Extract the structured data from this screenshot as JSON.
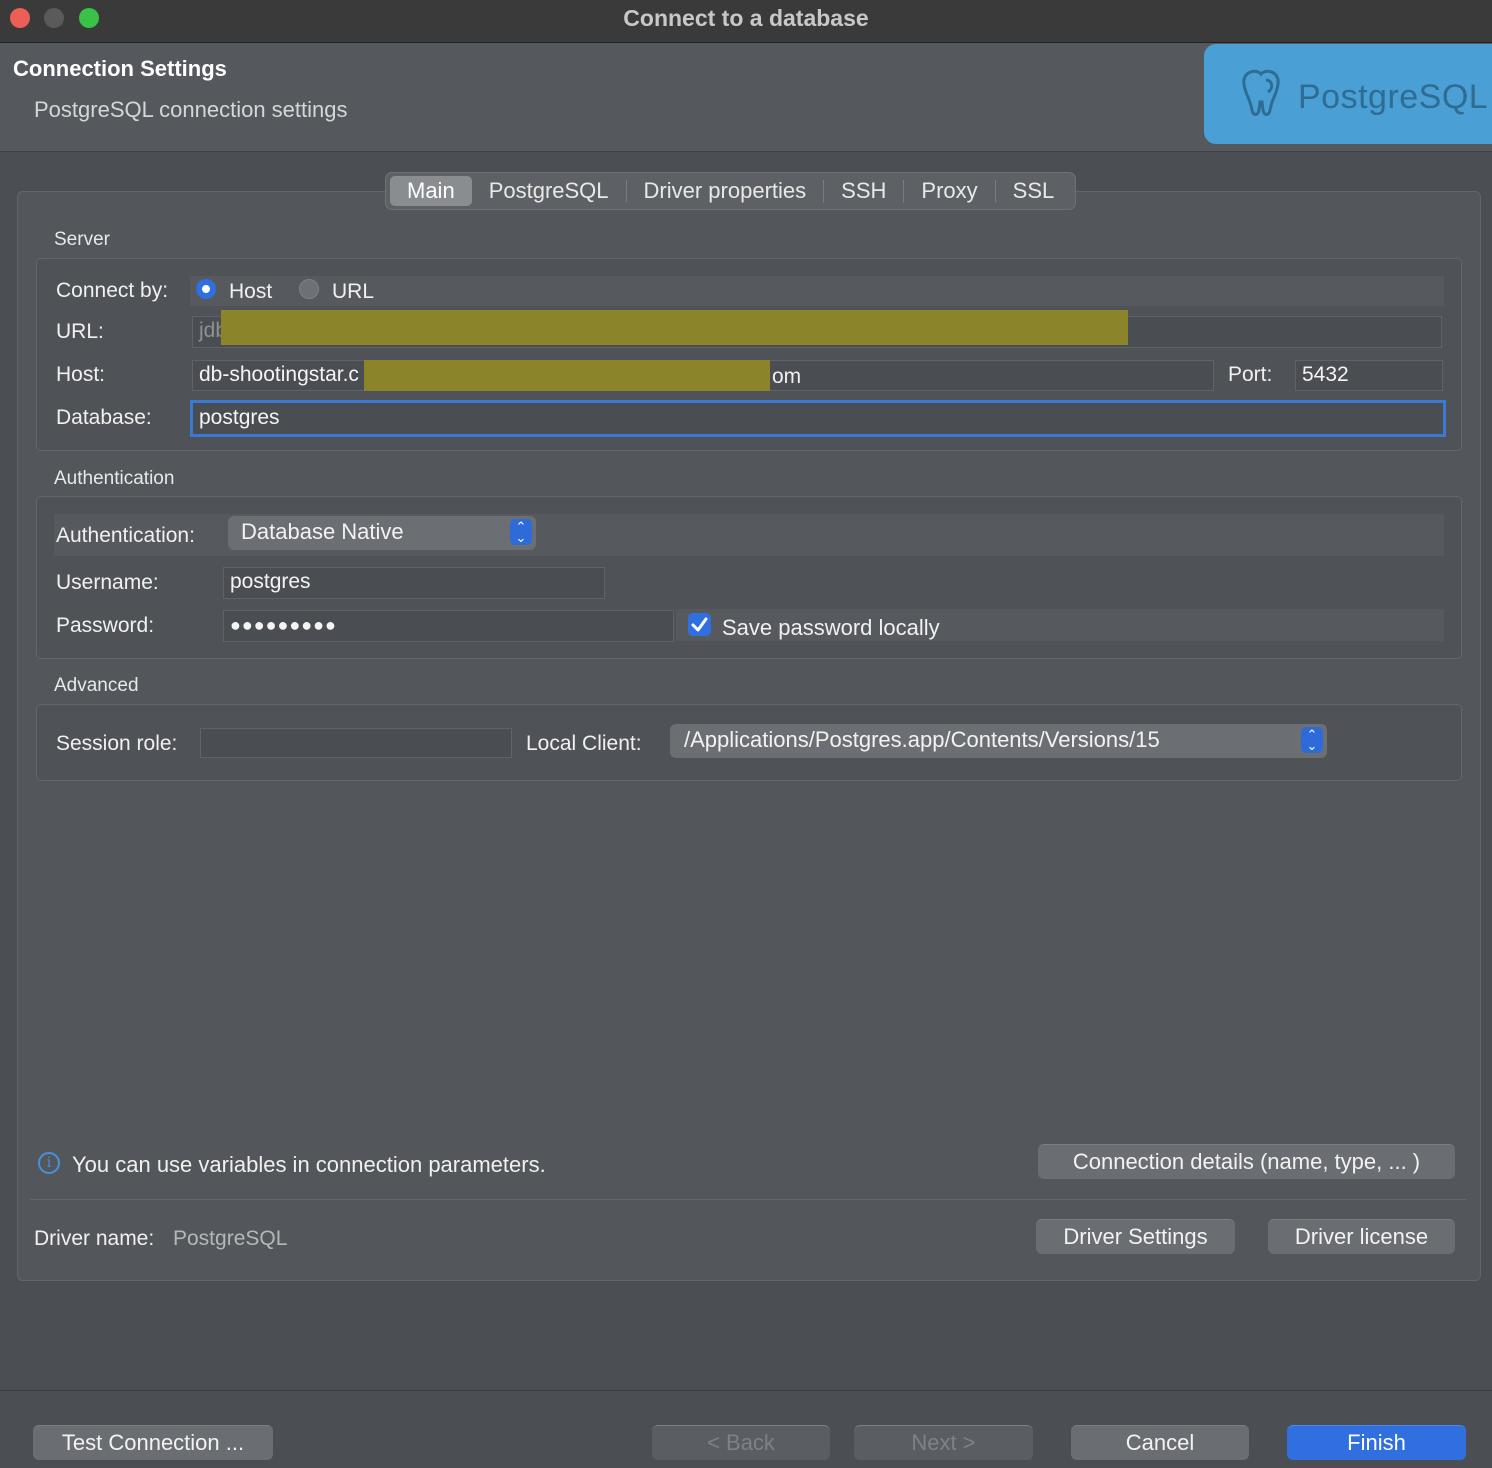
{
  "window": {
    "title": "Connect to a database"
  },
  "header": {
    "title": "Connection Settings",
    "subtitle": "PostgreSQL connection settings",
    "logo_text": "PostgreSQL"
  },
  "tabs": [
    {
      "label": "Main",
      "active": true
    },
    {
      "label": "PostgreSQL"
    },
    {
      "label": "Driver properties"
    },
    {
      "label": "SSH"
    },
    {
      "label": "Proxy"
    },
    {
      "label": "SSL"
    }
  ],
  "server": {
    "section_label": "Server",
    "connect_by_label": "Connect by:",
    "option_host": "Host",
    "option_url": "URL",
    "selected": "Host",
    "url_label": "URL:",
    "url_value": "jdb",
    "host_label": "Host:",
    "host_value_start": "db-shootingstar.c",
    "host_value_end": "om",
    "port_label": "Port:",
    "port_value": "5432",
    "database_label": "Database:",
    "database_value": "postgres"
  },
  "auth": {
    "section_label": "Authentication",
    "auth_label": "Authentication:",
    "auth_value": "Database Native",
    "username_label": "Username:",
    "username_value": "postgres",
    "password_label": "Password:",
    "password_value": "●●●●●●●●●",
    "save_password_label": "Save password locally",
    "save_password_checked": true
  },
  "advanced": {
    "section_label": "Advanced",
    "session_role_label": "Session role:",
    "session_role_value": "",
    "local_client_label": "Local Client:",
    "local_client_value": "/Applications/Postgres.app/Contents/Versions/15"
  },
  "info": {
    "text": "You can use variables in connection parameters."
  },
  "connection_details_button": "Connection details (name, type, ... )",
  "driver": {
    "name_label": "Driver name:",
    "name_value": "PostgreSQL",
    "settings_button": "Driver Settings",
    "license_button": "Driver license"
  },
  "footer": {
    "test_connection": "Test Connection ...",
    "back": "< Back",
    "next": "Next >",
    "cancel": "Cancel",
    "finish": "Finish"
  },
  "colors": {
    "accent": "#2f6fe0",
    "close": "#ec5f57",
    "minimize": "#5a5a5a",
    "zoom": "#39c148",
    "logo_bg": "#4a9fd5"
  }
}
